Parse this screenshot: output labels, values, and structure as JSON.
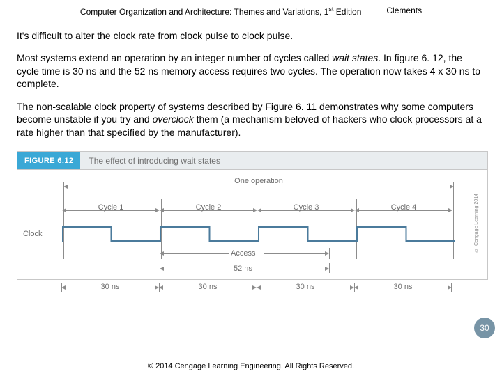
{
  "header": {
    "book_title_prefix": "Computer Organization and Architecture: Themes and Variations, 1",
    "book_title_sup": "st",
    "book_title_suffix": " Edition",
    "author": "Clements"
  },
  "body": {
    "p1": "It's difficult to alter the clock rate from clock pulse to clock pulse.",
    "p2a": "Most systems extend an operation by an integer number of cycles called ",
    "p2i": "wait states",
    "p2b": ". In figure 6. 12, the cycle time is 30 ns and the 52 ns memory access requires two cycles. The operation now takes 4 x 30 ns to complete.",
    "p3a": "The non-scalable clock property of systems described by Figure 6. 11 demonstrates why some computers become unstable if you try and ",
    "p3i": "overclock",
    "p3b": " them (a mechanism beloved of hackers who clock processors at a rate higher than that specified by the manufacturer)."
  },
  "figure": {
    "tag": "FIGURE 6.12",
    "title": "The effect of introducing wait states",
    "operation_label": "One operation",
    "cycles": [
      "Cycle 1",
      "Cycle 2",
      "Cycle 3",
      "Cycle 4"
    ],
    "clock_label": "Clock",
    "access_label": "Access",
    "access_ns": "52 ns",
    "cycle_ns": [
      "30 ns",
      "30 ns",
      "30 ns",
      "30 ns"
    ],
    "side_copyright": "© Cengage Learning 2014"
  },
  "page_number": "30",
  "footer": "© 2014 Cengage Learning Engineering. All Rights Reserved."
}
